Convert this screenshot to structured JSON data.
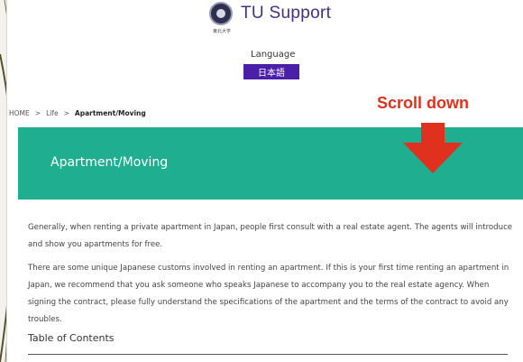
{
  "header": {
    "logo_text": "TU Support",
    "logo_subtext": "東北大学",
    "language_label": "Language",
    "language_button": "日本語"
  },
  "breadcrumb": {
    "home": "HOME",
    "life": "Life",
    "current": "Apartment/Moving",
    "separator": ">"
  },
  "annotation": {
    "text": "Scroll down",
    "color": "#e0301e"
  },
  "banner": {
    "title": "Apartment/Moving",
    "color": "#1fae8f"
  },
  "content": {
    "paragraph1": "Generally, when renting a private apartment in Japan, people first consult with a real estate agent. The agents will introduce and show you apartments for free.",
    "paragraph2": "There are some unique Japanese customs involved in renting an apartment. If this is your first time renting an apartment in Japan, we recommend that you ask someone who speaks Japanese to accompany you to the real estate agency. When signing the contract, please fully understand the specifications of the apartment and the terms of the contract to avoid any troubles.",
    "toc_title": "Table of Contents"
  }
}
